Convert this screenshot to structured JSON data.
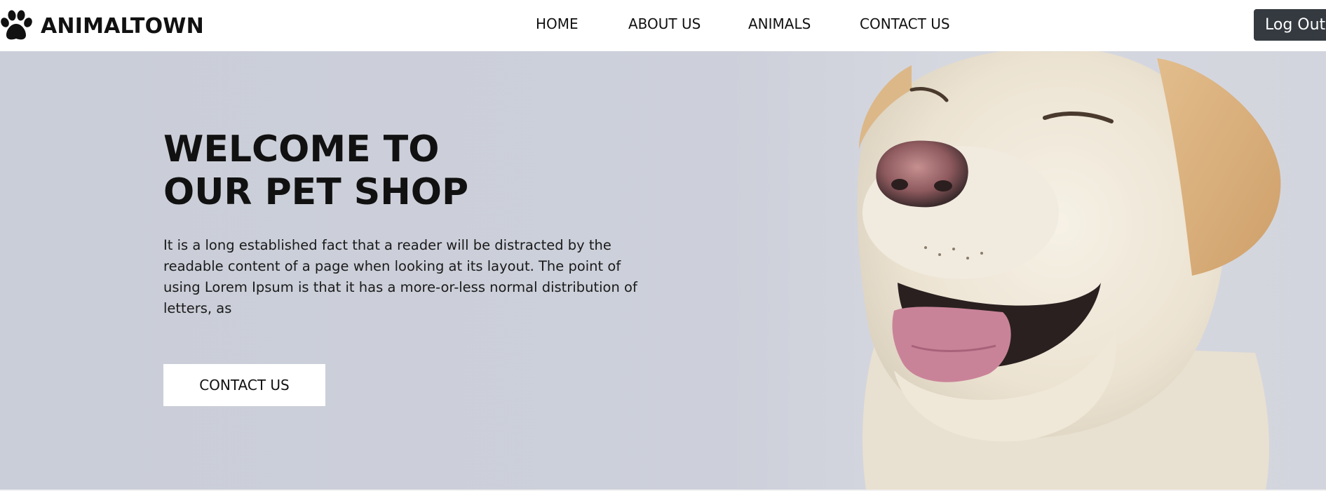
{
  "brand": {
    "name": "ANIMALTOWN",
    "logo_icon": "paw-icon"
  },
  "nav": {
    "items": [
      {
        "label": "HOME"
      },
      {
        "label": "ABOUT US"
      },
      {
        "label": "ANIMALS"
      },
      {
        "label": "CONTACT US"
      }
    ],
    "logout_label": "Log Out"
  },
  "hero": {
    "title_line1": "WELCOME TO",
    "title_line2": "OUR PET SHOP",
    "description": "It is a long established fact that a reader will be distracted by the readable content of a page when looking at its layout. The point of using Lorem Ipsum is that it has a more-or-less normal distribution of letters, as",
    "cta_label": "CONTACT US",
    "image_subject": "smiling yellow labrador retriever"
  },
  "colors": {
    "hero_background": "#cbcfd9",
    "logout_background": "#343a40",
    "text": "#111111"
  }
}
